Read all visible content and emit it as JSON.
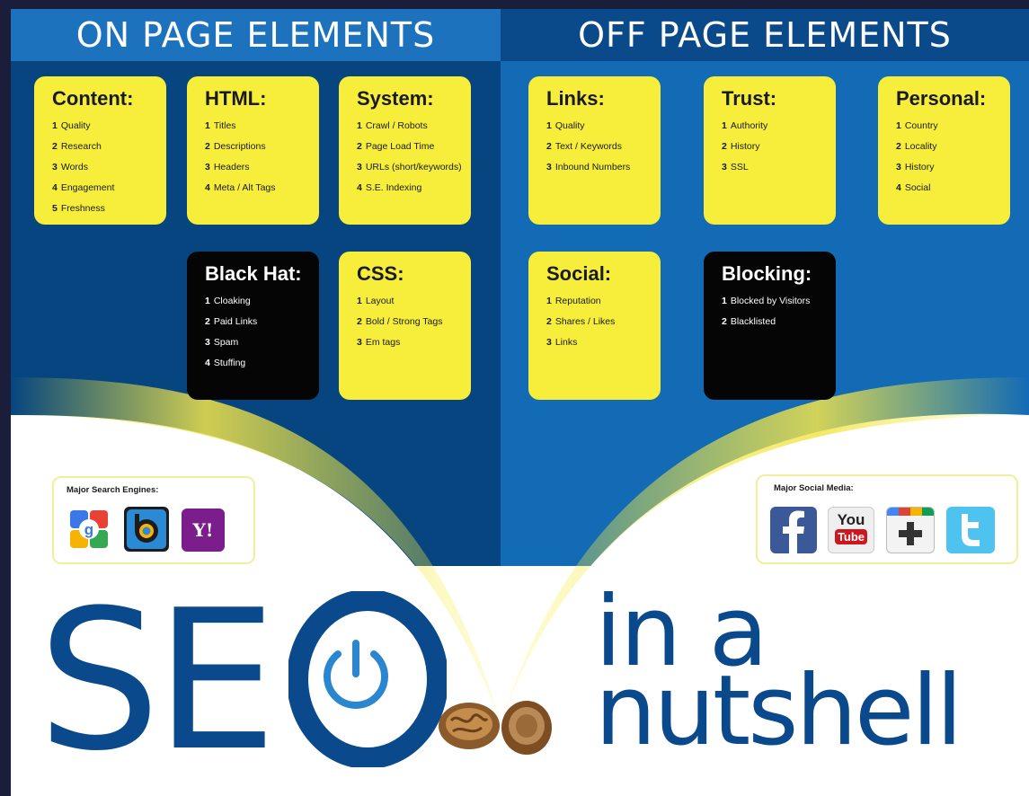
{
  "header": {
    "on_page": "ON PAGE ELEMENTS",
    "off_page": "OFF PAGE ELEMENTS"
  },
  "cards": [
    {
      "title": "Content:",
      "items": [
        [
          "1",
          "Quality"
        ],
        [
          "2",
          "Research"
        ],
        [
          "3",
          "Words"
        ],
        [
          "4",
          "Engagement"
        ],
        [
          "5",
          "Freshness"
        ]
      ]
    },
    {
      "title": "HTML:",
      "items": [
        [
          "1",
          "Titles"
        ],
        [
          "2",
          "Descriptions"
        ],
        [
          "3",
          "Headers"
        ],
        [
          "4",
          "Meta / Alt Tags"
        ]
      ]
    },
    {
      "title": "System:",
      "items": [
        [
          "1",
          "Crawl / Robots"
        ],
        [
          "2",
          "Page Load Time"
        ],
        [
          "3",
          "URLs (short/keywords)"
        ],
        [
          "4",
          "S.E. Indexing"
        ]
      ]
    },
    {
      "title": "Black Hat:",
      "items": [
        [
          "1",
          "Cloaking"
        ],
        [
          "2",
          "Paid Links"
        ],
        [
          "3",
          "Spam"
        ],
        [
          "4",
          "Stuffing"
        ]
      ]
    },
    {
      "title": "CSS:",
      "items": [
        [
          "1",
          "Layout"
        ],
        [
          "2",
          "Bold / Strong Tags"
        ],
        [
          "3",
          "Em tags"
        ]
      ]
    },
    {
      "title": "Links:",
      "items": [
        [
          "1",
          "Quality"
        ],
        [
          "2",
          "Text / Keywords"
        ],
        [
          "3",
          "Inbound Numbers"
        ]
      ]
    },
    {
      "title": "Trust:",
      "items": [
        [
          "1",
          "Authority"
        ],
        [
          "2",
          "History"
        ],
        [
          "3",
          "SSL"
        ]
      ]
    },
    {
      "title": "Personal:",
      "items": [
        [
          "1",
          "Country"
        ],
        [
          "2",
          "Locality"
        ],
        [
          "3",
          "History"
        ],
        [
          "4",
          "Social"
        ]
      ]
    },
    {
      "title": "Social:",
      "items": [
        [
          "1",
          "Reputation"
        ],
        [
          "2",
          "Shares / Likes"
        ],
        [
          "3",
          "Links"
        ]
      ]
    },
    {
      "title": "Blocking:",
      "items": [
        [
          "1",
          "Blocked by Visitors"
        ],
        [
          "2",
          "Blacklisted"
        ]
      ]
    }
  ],
  "search_engines": {
    "title": "Major Search Engines:",
    "icons": [
      "google-icon",
      "bing-icon",
      "yahoo-icon"
    ],
    "yahoo_text": "Y!"
  },
  "social_media": {
    "title": "Major Social Media:",
    "icons": [
      "facebook-icon",
      "youtube-icon",
      "google-plus-icon",
      "twitter-icon"
    ],
    "youtube_top": "You",
    "youtube_bottom": "Tube"
  },
  "wordmark": {
    "seo": "SE",
    "in_a": "in a",
    "nutshell": "nutshell"
  },
  "colors": {
    "dark_blue": "#06457f",
    "mid_blue": "#136bb5",
    "card_yellow": "#f6ee3a",
    "card_black": "#050505",
    "wordmark_blue": "#0a4a8c"
  }
}
